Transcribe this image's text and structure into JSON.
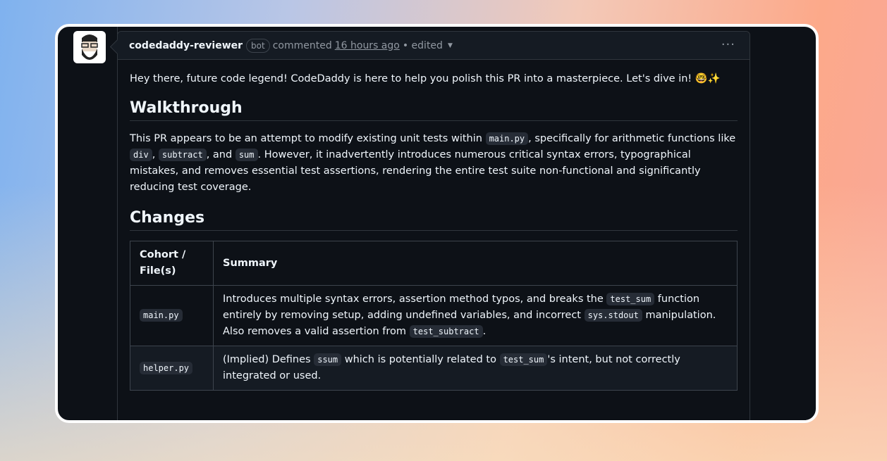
{
  "comment": {
    "author": "codedaddy-reviewer",
    "badge": "bot",
    "action": "commented",
    "timestamp": "16 hours ago",
    "edited": "• edited",
    "menu_icon": "kebab-horizontal-icon"
  },
  "body": {
    "intro": "Hey there, future code legend! CodeDaddy is here to help you polish this PR into a masterpiece. Let's dive in! 🤓✨",
    "walkthrough_heading": "Walkthrough",
    "walk": [
      "This PR appears to be an attempt to modify existing unit tests within ",
      "main.py",
      ", specifically for arithmetic functions like ",
      "div",
      ", ",
      "subtract",
      ", and ",
      "sum",
      ". However, it inadvertently introduces numerous critical syntax errors, typographical mistakes, and removes essential test assertions, rendering the entire test suite non-functional and significantly reducing test coverage."
    ],
    "changes_heading": "Changes",
    "table": {
      "headers": [
        "Cohort / File(s)",
        "Summary"
      ],
      "rows": [
        {
          "file": "main.py",
          "s": [
            "Introduces multiple syntax errors, assertion method typos, and breaks the ",
            "test_sum",
            " function entirely by removing setup, adding undefined variables, and incorrect ",
            "sys.stdout",
            " manipulation. Also removes a valid assertion from ",
            "test_subtract",
            "."
          ]
        },
        {
          "file": "helper.py",
          "s": [
            "(Implied) Defines ",
            "ssum",
            " which is potentially related to ",
            "test_sum",
            "'s intent, but not correctly integrated or used."
          ]
        }
      ]
    }
  }
}
